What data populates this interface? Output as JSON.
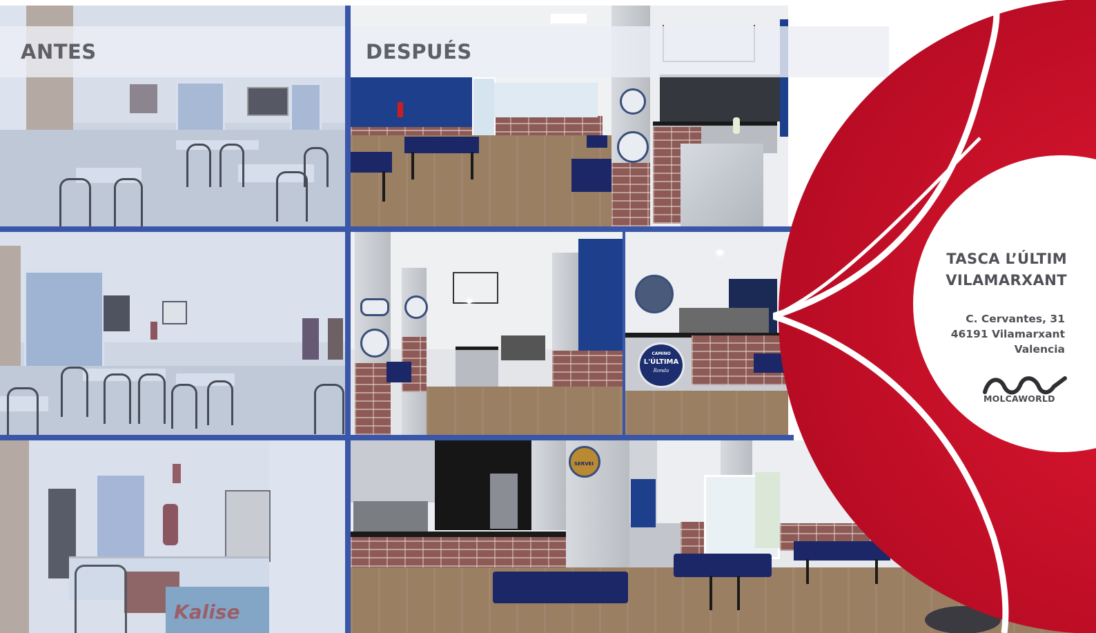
{
  "labels": {
    "before": "ANTES",
    "after": "DESPUÉS"
  },
  "venue": {
    "name_line1": "TASCA L’ÚLTIM",
    "name_line2": "VILAMARXANT",
    "address_line1": "C. Cervantes, 31",
    "address_line2": "46191 Vilamarxant",
    "address_line3": "Valencia"
  },
  "logo": {
    "text": "MOLCAWORLD",
    "icon": "molcaworld-wave-logo"
  },
  "photo_text": {
    "bar_badge_line1": "CAMINO",
    "bar_badge_line2": "L'ÚLTIMA",
    "bar_badge_line3": "Ronda",
    "ice_cream_sign": "Kalise",
    "bottom_sign": "SERVEI"
  },
  "colors": {
    "brand_red": "#d0112b",
    "accent_blue": "#3a56a8",
    "wall_blue": "#1e3f8c",
    "label_gray": "#5f6066"
  }
}
